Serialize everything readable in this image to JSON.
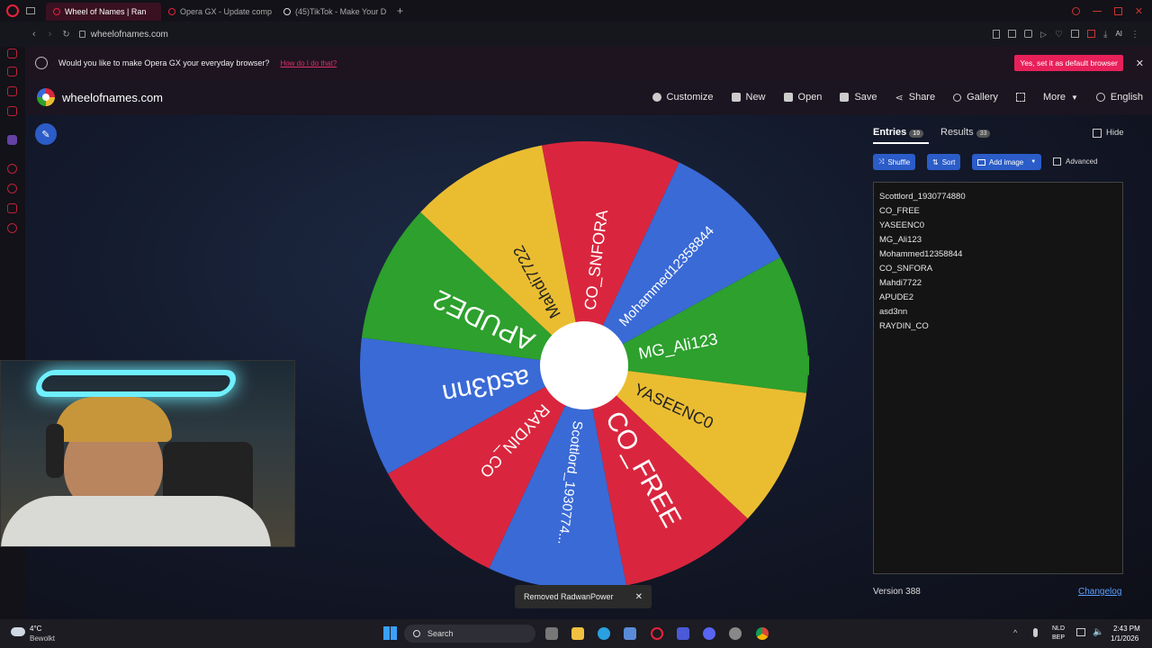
{
  "browser": {
    "tabs": [
      {
        "label": "Wheel of Names | Ran",
        "active": true
      },
      {
        "label": "Opera GX - Update comp",
        "active": false
      },
      {
        "label": "(45)TikTok - Make Your D",
        "active": false
      }
    ],
    "url": "wheelofnames.com"
  },
  "notification": {
    "text": "Would you like to make Opera GX your everyday browser?",
    "link": "How do I do that?",
    "button": "Yes, set it as default browser"
  },
  "site": {
    "logo_text": "wheelofnames.com",
    "nav": [
      {
        "label": "Customize",
        "icon": "palette-icon"
      },
      {
        "label": "New",
        "icon": "file-icon"
      },
      {
        "label": "Open",
        "icon": "folder-icon"
      },
      {
        "label": "Save",
        "icon": "save-icon"
      },
      {
        "label": "Share",
        "icon": "share-icon"
      },
      {
        "label": "Gallery",
        "icon": "search-icon"
      },
      {
        "label": "",
        "icon": "fullscreen-icon"
      },
      {
        "label": "More",
        "icon": "chevron-down-icon"
      },
      {
        "label": "English",
        "icon": "globe-icon"
      }
    ]
  },
  "wheel": {
    "segments": [
      {
        "label": "MG_Ali123",
        "color": "#2da02d"
      },
      {
        "label": "YASEENC0",
        "color": "#eabd31"
      },
      {
        "label": "CO_FREE",
        "color": "#d9263e"
      },
      {
        "label": "Scottlord_1930774...",
        "color": "#3a6ad6"
      },
      {
        "label": "RAYDIN_CO",
        "color": "#d9263e"
      },
      {
        "label": "asd3nn",
        "color": "#3a6ad6"
      },
      {
        "label": "APUDE2",
        "color": "#2da02d"
      },
      {
        "label": "Mahdi7722",
        "color": "#eabd31"
      },
      {
        "label": "CO_SNFORA",
        "color": "#d9263e"
      },
      {
        "label": "Mohammed12358844",
        "color": "#3a6ad6"
      }
    ],
    "pointer_color": "#2da02d"
  },
  "panel": {
    "tab_entries": "Entries",
    "entries_count": "10",
    "tab_results": "Results",
    "results_count": "33",
    "hide_label": "Hide",
    "shuffle": "Shuffle",
    "sort": "Sort",
    "add_image": "Add image",
    "advanced": "Advanced",
    "entries": [
      "Scottlord_1930774880",
      "CO_FREE",
      "YASEENC0",
      "MG_Ali123",
      "Mohammed12358844",
      "CO_SNFORA",
      "Mahdi7722",
      "APUDE2",
      "asd3nn",
      "RAYDIN_CO"
    ],
    "version": "Version 388",
    "changelog": "Changelog"
  },
  "toast": {
    "text": "Removed RadwanPower",
    "close": "✕"
  },
  "taskbar": {
    "weather_temp": "4°C",
    "weather_desc": "Bewolkt",
    "search": "Search",
    "lang1": "NLD",
    "lang2": "BEP",
    "time": "2:43 PM",
    "date": "1/1/2026"
  }
}
